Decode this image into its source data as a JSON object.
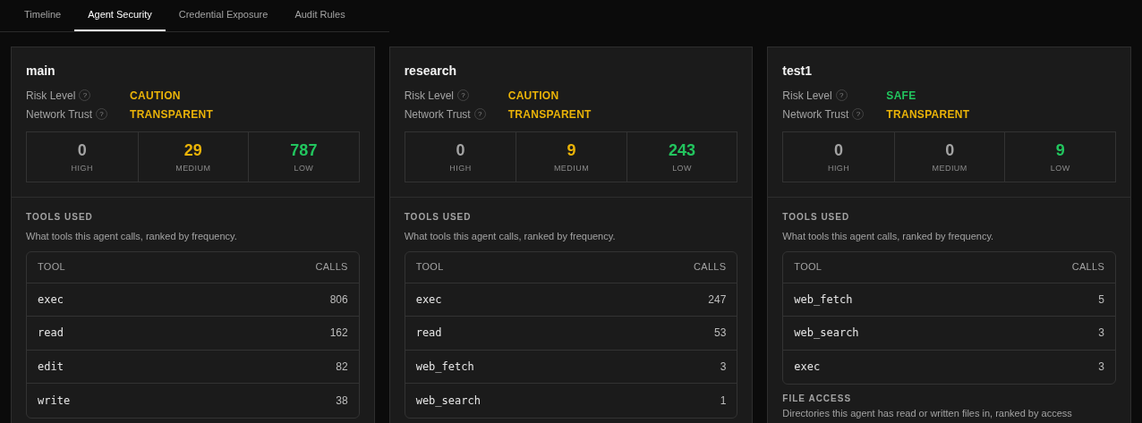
{
  "tabs": [
    {
      "label": "Timeline",
      "selected": false
    },
    {
      "label": "Agent Security",
      "selected": true
    },
    {
      "label": "Credential Exposure",
      "selected": false
    },
    {
      "label": "Audit Rules",
      "selected": false
    }
  ],
  "agents": [
    {
      "name": "main",
      "risk_level": {
        "label": "Risk Level",
        "help": "?",
        "value": "CAUTION",
        "color": "#eab308"
      },
      "network_trust": {
        "label": "Network Trust",
        "help": "?",
        "value": "TRANSPARENT",
        "color": "#eab308"
      },
      "counts": [
        {
          "value": "0",
          "label": "HIGH",
          "color": "#a3a3a3"
        },
        {
          "value": "29",
          "label": "MEDIUM",
          "color": "#eab308"
        },
        {
          "value": "787",
          "label": "LOW",
          "color": "#22c55e"
        }
      ],
      "tools": {
        "title": "TOOLS USED",
        "description": "What tools this agent calls, ranked by frequency.",
        "columns": [
          "TOOL",
          "CALLS"
        ],
        "rows": [
          [
            "exec",
            "806"
          ],
          [
            "read",
            "162"
          ],
          [
            "edit",
            "82"
          ],
          [
            "write",
            "38"
          ]
        ]
      }
    },
    {
      "name": "research",
      "risk_level": {
        "label": "Risk Level",
        "help": "?",
        "value": "CAUTION",
        "color": "#eab308"
      },
      "network_trust": {
        "label": "Network Trust",
        "help": "?",
        "value": "TRANSPARENT",
        "color": "#eab308"
      },
      "counts": [
        {
          "value": "0",
          "label": "HIGH",
          "color": "#a3a3a3"
        },
        {
          "value": "9",
          "label": "MEDIUM",
          "color": "#eab308"
        },
        {
          "value": "243",
          "label": "LOW",
          "color": "#22c55e"
        }
      ],
      "tools": {
        "title": "TOOLS USED",
        "description": "What tools this agent calls, ranked by frequency.",
        "columns": [
          "TOOL",
          "CALLS"
        ],
        "rows": [
          [
            "exec",
            "247"
          ],
          [
            "read",
            "53"
          ],
          [
            "web_fetch",
            "3"
          ],
          [
            "web_search",
            "1"
          ]
        ]
      }
    },
    {
      "name": "test1",
      "risk_level": {
        "label": "Risk Level",
        "help": "?",
        "value": "SAFE",
        "color": "#22c55e"
      },
      "network_trust": {
        "label": "Network Trust",
        "help": "?",
        "value": "TRANSPARENT",
        "color": "#eab308"
      },
      "counts": [
        {
          "value": "0",
          "label": "HIGH",
          "color": "#a3a3a3"
        },
        {
          "value": "0",
          "label": "MEDIUM",
          "color": "#a3a3a3"
        },
        {
          "value": "9",
          "label": "LOW",
          "color": "#22c55e"
        }
      ],
      "tools": {
        "title": "TOOLS USED",
        "description": "What tools this agent calls, ranked by frequency.",
        "columns": [
          "TOOL",
          "CALLS"
        ],
        "rows": [
          [
            "web_fetch",
            "5"
          ],
          [
            "web_search",
            "3"
          ],
          [
            "exec",
            "3"
          ]
        ]
      },
      "file_access": {
        "title": "FILE ACCESS",
        "description": "Directories this agent has read or written files in, ranked by access"
      }
    }
  ]
}
